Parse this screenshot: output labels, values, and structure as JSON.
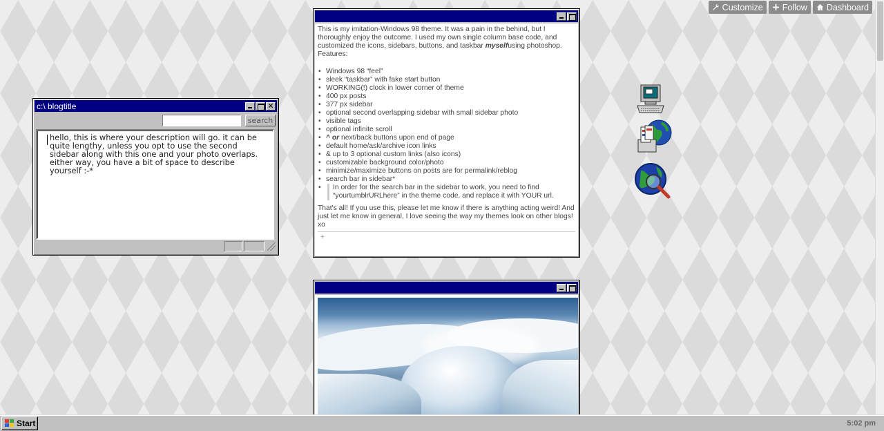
{
  "tumblr_controls": {
    "customize": "Customize",
    "follow": "Follow",
    "dashboard": "Dashboard"
  },
  "sidebar": {
    "title": "c:\\ blogtitle",
    "search_placeholder": "",
    "search_button": "search",
    "description": "hello, this is where your description will go. it can be quite lengthy, unless you opt to use the second sidebar along with this one and your photo overlaps. either way, you have a bit of space to describe yourself :-*"
  },
  "text_post": {
    "intro_1": "This is my imitation-Windows 98 theme. It was a pain in the behind, but I thoroughly enjoy the outcome. I used my own single column base code, and customized the icons, sidebars, buttons, and taskbar ",
    "intro_emph": "myself",
    "intro_2": "using photoshop.",
    "features_label": "Features:",
    "features": [
      "Windows 98 “feel”",
      "sleek “taskbar” with fake start button",
      "WORKING(!) clock in lower corner of theme",
      "400  px posts",
      "377 px sidebar",
      "optional second overlapping sidebar with small sidebar photo",
      "visible tags",
      "optional infinite scroll"
    ],
    "feature_nav_prefix": "^ ",
    "feature_nav_or": "or",
    "feature_nav_rest": " next/back buttons upon end of page",
    "features_more": [
      "default home/ask/archive icon links",
      "& up to 3 optional custom links (also icons)",
      "customizable background color/photo",
      "minimize/maximize buttons on posts are for permalink/reblog",
      "search bar in sidebar*"
    ],
    "search_note": "In order for the search bar in the sidebar to work, you need to find “yourtumblrURLhere” in the theme code, and replace it with YOUR url.",
    "outro": "That's all! If you use this, please let me know if there is anything acting weird! And just let me know in general, I love seeing the way my themes look on other blogs! xo",
    "notes": "+"
  },
  "taskbar": {
    "start_label": "Start",
    "clock": "5:02 pm"
  },
  "desktop_icons": [
    "computer-icon",
    "documents-icon",
    "internet-search-icon"
  ],
  "colors": {
    "titlebar": "#000080",
    "window_face": "#c0c0c0",
    "tumblr_button": "#8c8c8c"
  }
}
